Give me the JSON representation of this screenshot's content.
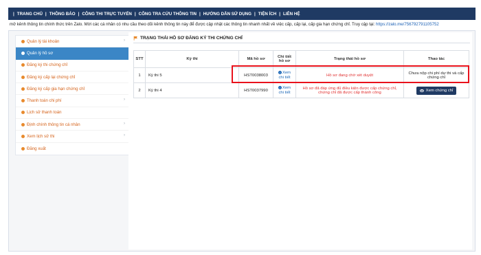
{
  "nav": {
    "items": [
      "TRANG CHỦ",
      "THÔNG BÁO",
      "CÔNG THI TRỰC TUYẾN",
      "CÔNG TRA CỨU THÔNG TIN",
      "HƯỚNG DẪN SỬ DỤNG",
      "TIỆN ÍCH",
      "LIÊN HỆ"
    ]
  },
  "marquee": {
    "text": "mở kênh thông tin chính thức trên Zalo. Mời các cá nhân có nhu cầu theo dõi kênh thông tin này để được cập nhật các thông tin nhanh nhất về việc cấp, cấp lại, cấp gia hạn chứng chỉ. Truy cập tại: ",
    "link": "https://zalo.me/756792791105752"
  },
  "sidebar": {
    "items": [
      {
        "label": "Quản lý tài khoản",
        "chevron": "›"
      },
      {
        "label": "Quản lý hồ sơ",
        "chevron": ""
      },
      {
        "label": "Đăng ký thi chứng chỉ",
        "chevron": ""
      },
      {
        "label": "Đăng ký cấp lại chứng chỉ",
        "chevron": ""
      },
      {
        "label": "Đăng ký cấp gia hạn chứng chỉ",
        "chevron": ""
      },
      {
        "label": "Thanh toán chi phí",
        "chevron": "›"
      },
      {
        "label": "Lịch sử thanh toán",
        "chevron": ""
      },
      {
        "label": "Định chính thông tin cá nhân",
        "chevron": "›"
      },
      {
        "label": "Xem lịch sử thi",
        "chevron": "›"
      },
      {
        "label": "Đăng xuất",
        "chevron": ""
      }
    ]
  },
  "section": {
    "title": "TRẠNG THÁI HỒ SƠ ĐĂNG KÝ THI CHỨNG CHỈ"
  },
  "table": {
    "headers": {
      "stt": "STT",
      "exam": "Kỳ thi",
      "code": "Mã hồ sơ",
      "detail_line1": "Chi tiết",
      "detail_line2": "hồ sơ",
      "status": "Trạng thái hồ sơ",
      "action": "Thao tác"
    },
    "rows": [
      {
        "stt": "1",
        "exam": "Kỳ thi 5",
        "code": "HST0038003",
        "detail_line1": "Xem",
        "detail_line2": "chi tiết",
        "status_line1": "Hồ sơ đang chờ xét duyệt",
        "status_line2": "",
        "action_line1": "Chưa nộp chi phí dự thi và cấp",
        "action_line2": "chứng chỉ"
      },
      {
        "stt": "2",
        "exam": "Kỳ thi 4",
        "code": "HST0037990",
        "detail_line1": "Xem",
        "detail_line2": "chi tiết",
        "status_line1": "Hồ sơ đã đáp ứng đủ điều kiện được cấp chứng chỉ,",
        "status_line2": "chứng chỉ đã được cấp thành công",
        "action_button": "Xem chứng chỉ"
      }
    ]
  },
  "colors": {
    "nav_bg": "#1f3a63",
    "sidebar_active": "#3b86c6",
    "sidebar_text": "#d5631b",
    "status_red": "#e03131",
    "link_blue": "#1a66b6",
    "highlight": "#e8111b"
  },
  "icons": {
    "section": "flag-icon",
    "detail": "info-circle-icon",
    "view": "eye-icon",
    "sidebar_bullet": "bullet-icon",
    "sidebar_chevron": "chevron-right-icon"
  }
}
